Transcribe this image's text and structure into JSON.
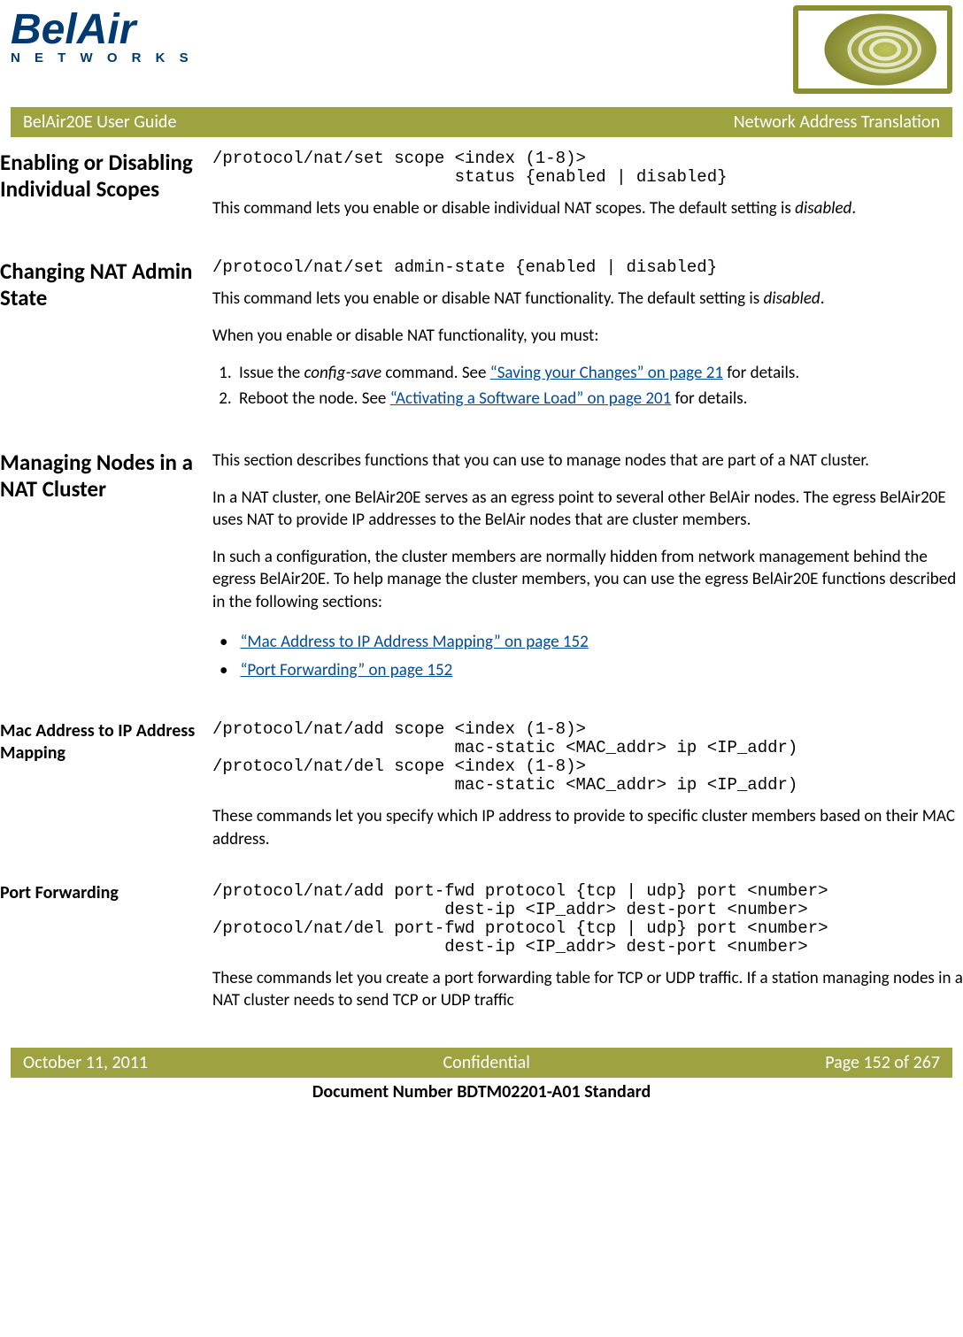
{
  "logo": {
    "main": "BelAir",
    "sub": "N E T W O R K S"
  },
  "header": {
    "left": "BelAir20E User Guide",
    "right": "Network Address Translation"
  },
  "sections": {
    "enabling": {
      "heading": "Enabling or Disabling Individual Scopes",
      "cmd": "/protocol/nat/set scope <index (1-8)>\n                        status {enabled | disabled}",
      "p1a": "This command lets you enable or disable individual NAT scopes. The default setting is ",
      "p1b": "disabled",
      "p1c": "."
    },
    "admin": {
      "heading": "Changing NAT Admin State",
      "cmd": "/protocol/nat/set admin-state {enabled | disabled}",
      "p1a": "This command lets you enable or disable NAT functionality. The default setting is ",
      "p1b": "disabled",
      "p1c": ".",
      "p2": "When you enable or disable NAT functionality, you must:",
      "li1a": "Issue the ",
      "li1b": "config-save",
      "li1c": " command. See ",
      "li1link": "“Saving your Changes” on page 21",
      "li1d": " for details.",
      "li2a": "Reboot the node. See ",
      "li2link": "“Activating a Software Load” on page 201",
      "li2b": " for details."
    },
    "managing": {
      "heading": "Managing Nodes in a NAT Cluster",
      "p1": "This section describes functions that you can use to manage nodes that are part of a NAT cluster.",
      "p2": "In a NAT cluster, one BelAir20E serves as an egress point to several other BelAir nodes. The egress BelAir20E uses NAT to provide IP addresses to the BelAir nodes that are cluster members.",
      "p3": "In such a configuration, the cluster members are normally hidden from network management behind the egress BelAir20E. To help manage the cluster members, you can use the egress BelAir20E functions described in the following sections:",
      "b1": "“Mac Address to IP Address Mapping” on page 152",
      "b2": "“Port Forwarding” on page 152"
    },
    "mac": {
      "heading": "Mac Address to IP Address Mapping",
      "cmd": "/protocol/nat/add scope <index (1-8)>\n                        mac-static <MAC_addr> ip <IP_addr)\n/protocol/nat/del scope <index (1-8)>\n                        mac-static <MAC_addr> ip <IP_addr)",
      "p1": "These commands let you specify which IP address to provide to specific cluster members based on their MAC address."
    },
    "port": {
      "heading": "Port Forwarding",
      "cmd": "/protocol/nat/add port-fwd protocol {tcp | udp} port <number>\n                       dest-ip <IP_addr> dest-port <number>\n/protocol/nat/del port-fwd protocol {tcp | udp} port <number>\n                       dest-ip <IP_addr> dest-port <number>",
      "p1": "These commands let you create a port forwarding table for TCP or UDP traffic. If a station managing nodes in a NAT cluster needs to send TCP or UDP traffic"
    }
  },
  "footer": {
    "left": "October 11, 2011",
    "center": "Confidential",
    "right": "Page 152 of 267"
  },
  "docnum": "Document Number BDTM02201-A01 Standard"
}
